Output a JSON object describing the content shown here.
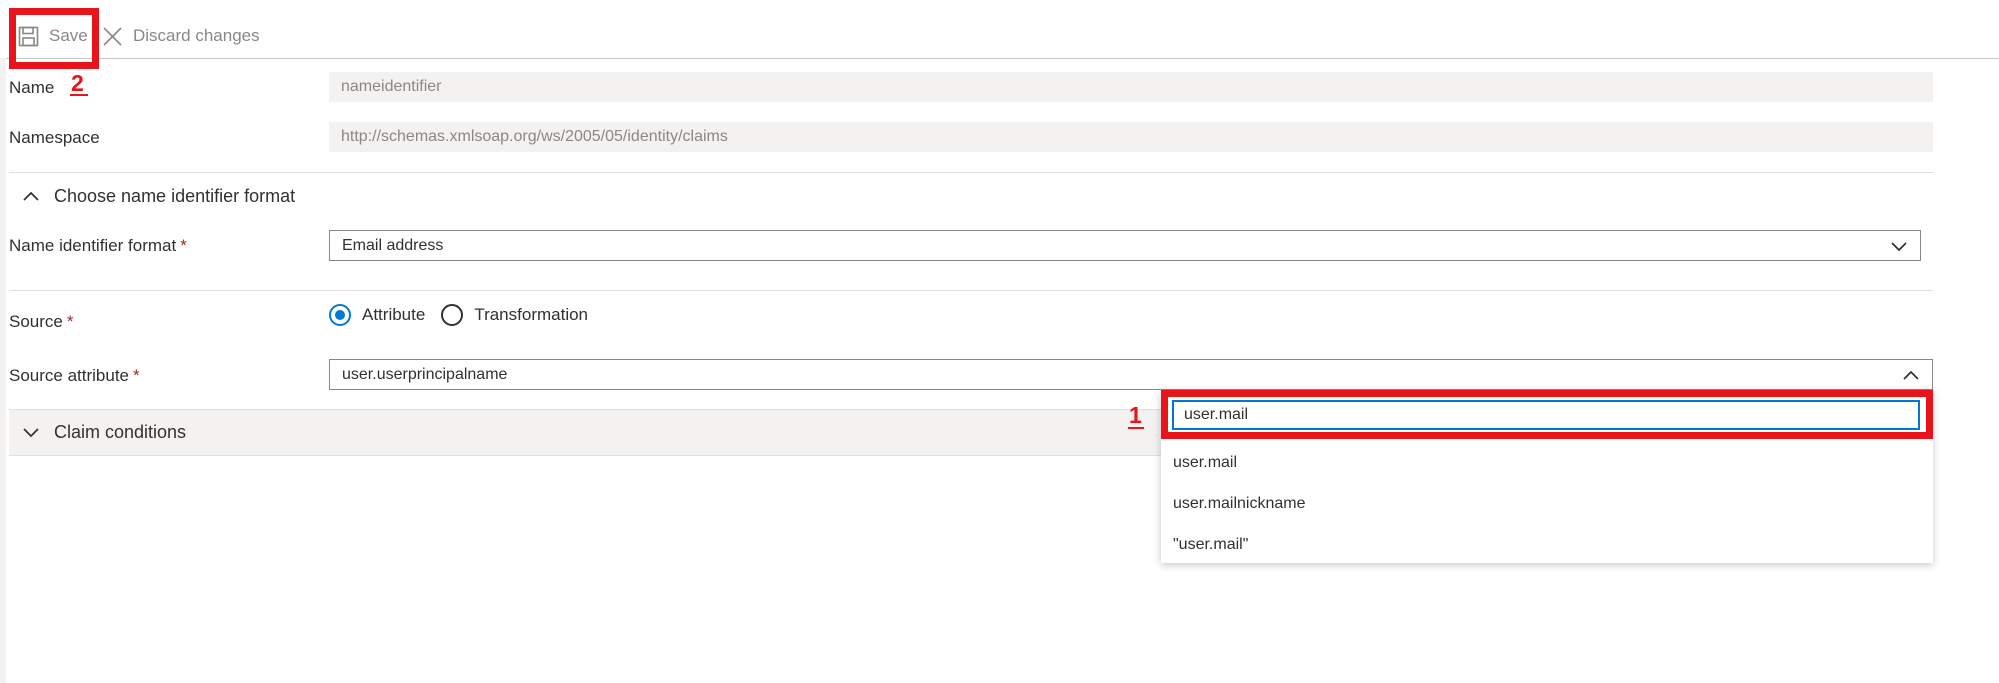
{
  "toolbar": {
    "save_label": "Save",
    "discard_label": "Discard changes"
  },
  "annotations": {
    "step1": "1",
    "step2": "2"
  },
  "form": {
    "name": {
      "label": "Name",
      "value": "nameidentifier"
    },
    "namespace": {
      "label": "Namespace",
      "value": "http://schemas.xmlsoap.org/ws/2005/05/identity/claims"
    },
    "name_id_section": {
      "label": "Choose name identifier format"
    },
    "name_id_format": {
      "label": "Name identifier format",
      "required_mark": "*",
      "value": "Email address"
    },
    "source": {
      "label": "Source",
      "required_mark": "*",
      "options": [
        {
          "label": "Attribute",
          "selected": true
        },
        {
          "label": "Transformation",
          "selected": false
        }
      ]
    },
    "source_attribute": {
      "label": "Source attribute",
      "required_mark": "*",
      "value": "user.userprincipalname",
      "search_value": "user.mail",
      "options": [
        "user.mail",
        "user.mailnickname",
        "\"user.mail\""
      ]
    },
    "claim_conditions": {
      "label": "Claim conditions"
    }
  },
  "colors": {
    "accent": "#0078d4",
    "highlight": "#e8141b",
    "required": "#a4262c"
  },
  "icons": {
    "save": "floppy-disk-icon",
    "discard": "close-icon",
    "expand": "chevron-up-icon",
    "collapse": "chevron-down-icon"
  }
}
